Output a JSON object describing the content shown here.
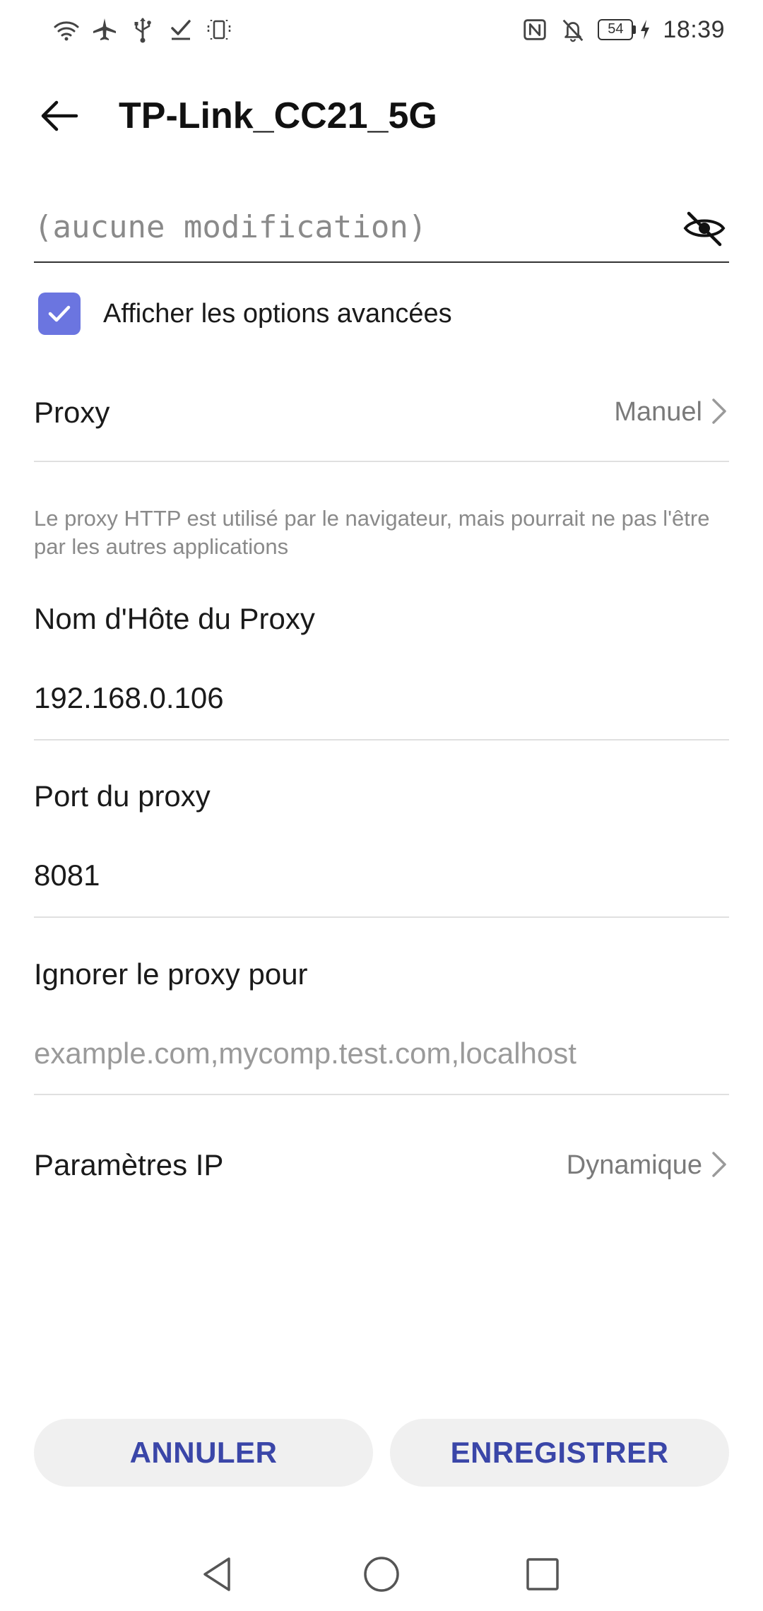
{
  "status_bar": {
    "left_icons": [
      "wifi-icon",
      "airplane-icon",
      "usb-icon",
      "task-check-icon",
      "screen-rotate-icon"
    ],
    "right_icons": [
      "nfc-icon",
      "bell-muted-icon"
    ],
    "battery_level": "54",
    "charging": true,
    "time": "18:39"
  },
  "header": {
    "title": "TP-Link_CC21_5G",
    "back_icon": "arrow-back-icon"
  },
  "password_field": {
    "placeholder": "(aucune modification)",
    "visibility_icon": "eye-off-icon"
  },
  "advanced_options": {
    "label": "Afficher les options avancées",
    "checked": true
  },
  "proxy": {
    "label": "Proxy",
    "value": "Manuel",
    "help_text": "Le proxy HTTP est utilisé par le navigateur, mais pourrait ne pas l'être par les autres applications"
  },
  "proxy_hostname": {
    "label": "Nom d'Hôte du Proxy",
    "value": "192.168.0.106"
  },
  "proxy_port": {
    "label": "Port du proxy",
    "value": "8081"
  },
  "proxy_bypass": {
    "label": "Ignorer le proxy pour",
    "placeholder": "example.com,mycomp.test.com,localhost"
  },
  "ip_settings": {
    "label": "Paramètres IP",
    "value": "Dynamique"
  },
  "buttons": {
    "cancel": "ANNULER",
    "save": "ENREGISTRER"
  },
  "colors": {
    "accent": "#6b75e0",
    "button_text": "#3a46a8",
    "button_bg": "#f0f0f0"
  },
  "nav_bar": {
    "icons": [
      "nav-back-icon",
      "nav-home-icon",
      "nav-recents-icon"
    ]
  }
}
